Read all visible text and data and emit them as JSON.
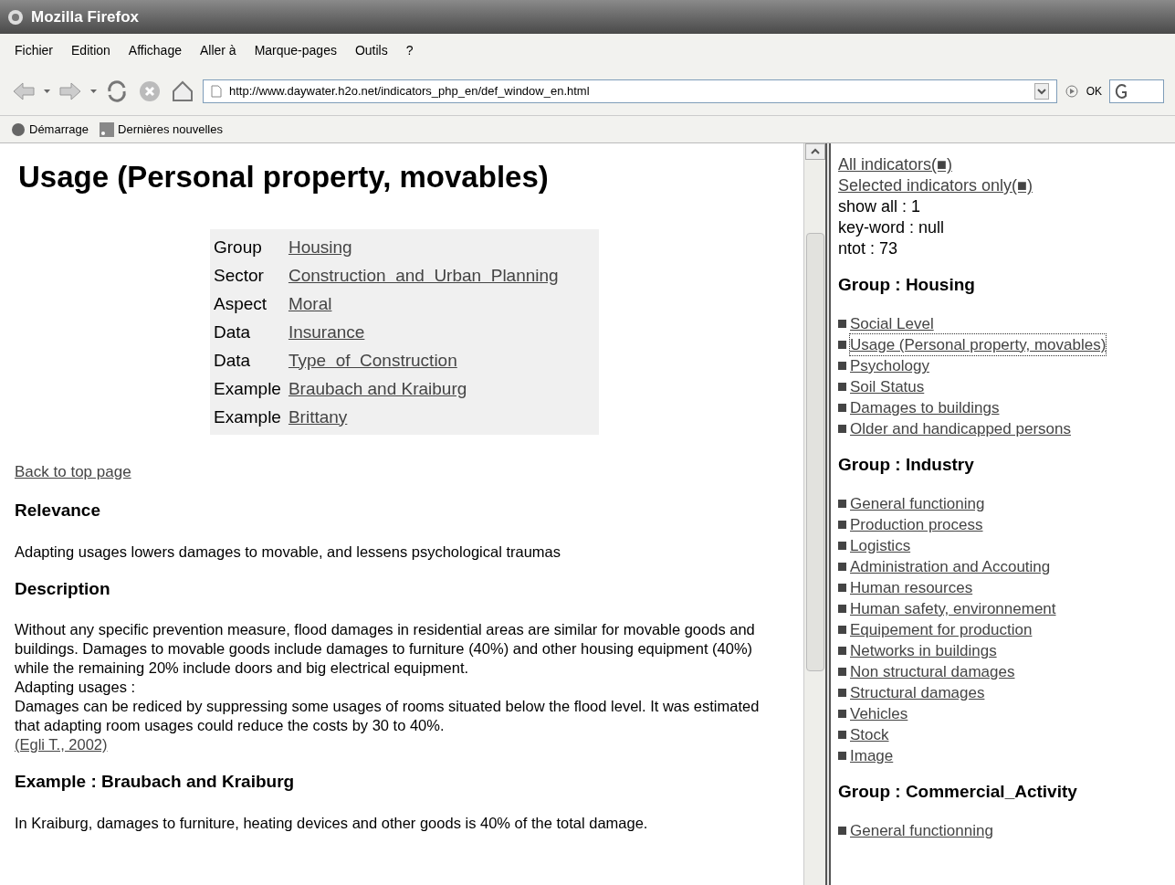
{
  "window": {
    "title": "Mozilla Firefox"
  },
  "menu": [
    "Fichier",
    "Edition",
    "Affichage",
    "Aller à",
    "Marque-pages",
    "Outils",
    "?"
  ],
  "address_bar": {
    "value": "http://www.daywater.h2o.net/indicators_php_en/def_window_en.html",
    "go_label": "OK"
  },
  "bookmarks": [
    {
      "label": "Démarrage",
      "kind": "page"
    },
    {
      "label": "Dernières nouvelles",
      "kind": "feed"
    }
  ],
  "main": {
    "title": "Usage (Personal property, movables)",
    "info_rows": [
      {
        "label": "Group",
        "value": "Housing"
      },
      {
        "label": "Sector",
        "value": "Construction  and  Urban  Planning"
      },
      {
        "label": "Aspect",
        "value": "Moral"
      },
      {
        "label": "Data",
        "value": "Insurance"
      },
      {
        "label": "Data",
        "value": "Type  of  Construction"
      },
      {
        "label": "Example",
        "value": "Braubach and Kraiburg"
      },
      {
        "label": "Example",
        "value": "Brittany"
      }
    ],
    "back_link": "Back to top page",
    "sections": [
      {
        "heading": "Relevance",
        "paragraphs": [
          "Adapting usages lowers damages to movable, and lessens psychological traumas"
        ]
      },
      {
        "heading": "Description",
        "paragraphs": [
          "Without any specific prevention measure, flood damages in residential areas are similar for movable goods and buildings. Damages to movable goods include damages to furniture (40%) and other housing equipment (40%) while the remaining 20% include doors and big electrical equipment.",
          "Adapting usages :",
          "Damages can be rediced by suppressing some usages of rooms situated below the flood level. It was estimated that adapting room usages could reduce the costs by 30 to 40%."
        ],
        "reference": "(Egli T., 2002)"
      },
      {
        "heading": "Example : Braubach and Kraiburg",
        "paragraphs": [
          "In Kraiburg, damages to furniture, heating devices and other goods is 40% of the total damage."
        ]
      }
    ]
  },
  "sidebar": {
    "links": [
      "All indicators(■)",
      "Selected indicators only(■)"
    ],
    "info": [
      "show all : 1",
      "key-word : null",
      "ntot : 73"
    ],
    "groups": [
      {
        "title": "Group : Housing",
        "items": [
          {
            "label": "Social Level",
            "focused": false
          },
          {
            "label": "Usage (Personal property, movables)",
            "focused": true
          },
          {
            "label": "Psychology",
            "focused": false
          },
          {
            "label": "Soil Status",
            "focused": false
          },
          {
            "label": "Damages to buildings",
            "focused": false
          },
          {
            "label": "Older and handicapped persons",
            "focused": false
          }
        ]
      },
      {
        "title": "Group : Industry",
        "items": [
          {
            "label": "General functioning",
            "focused": false
          },
          {
            "label": "Production process",
            "focused": false
          },
          {
            "label": "Logistics",
            "focused": false
          },
          {
            "label": "Administration and Accouting",
            "focused": false
          },
          {
            "label": "Human resources",
            "focused": false
          },
          {
            "label": "Human safety, environnement",
            "focused": false
          },
          {
            "label": "Equipement for production",
            "focused": false
          },
          {
            "label": "Networks in buildings",
            "focused": false
          },
          {
            "label": "Non structural damages",
            "focused": false
          },
          {
            "label": "Structural damages",
            "focused": false
          },
          {
            "label": "Vehicles",
            "focused": false
          },
          {
            "label": "Stock",
            "focused": false
          },
          {
            "label": "Image",
            "focused": false
          }
        ]
      },
      {
        "title": "Group : Commercial_Activity",
        "items": [
          {
            "label": "General functionning",
            "focused": false
          }
        ]
      }
    ]
  }
}
